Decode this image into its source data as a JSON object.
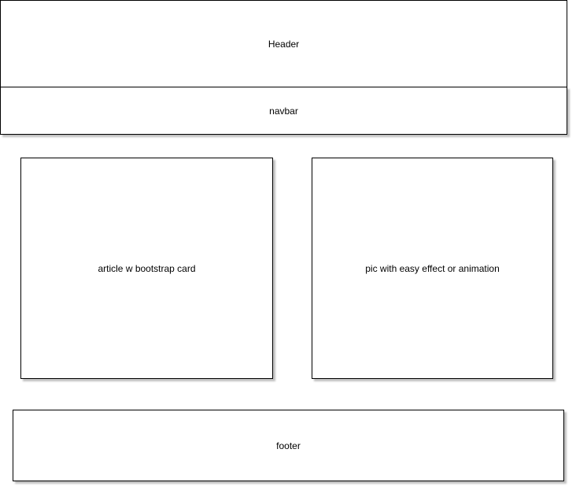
{
  "diagram": {
    "header": {
      "label": "Header"
    },
    "navbar": {
      "label": "navbar"
    },
    "article": {
      "label": "article w bootstrap card"
    },
    "pic": {
      "label": "pic with easy effect or animation"
    },
    "footer": {
      "label": "footer"
    }
  }
}
